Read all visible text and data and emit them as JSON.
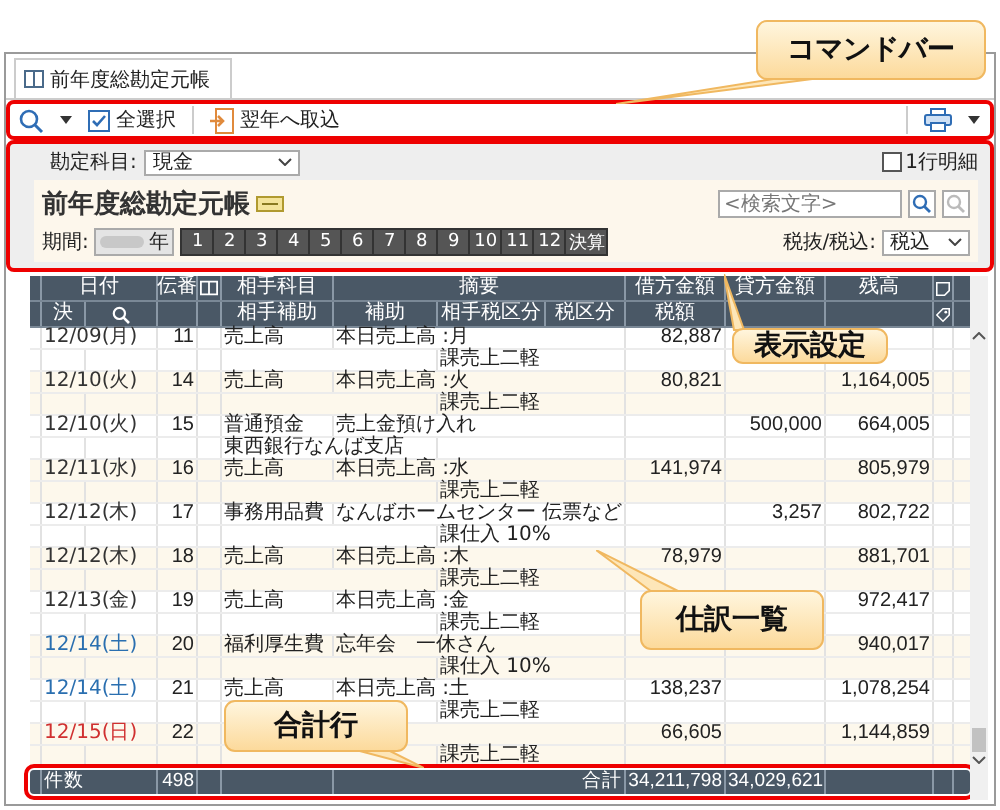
{
  "window": {
    "tab": {
      "label": "前年度総勘定元帳",
      "selected": true
    }
  },
  "command_bar": {
    "items": [
      {
        "kind": "search"
      },
      {
        "kind": "dropdown"
      },
      {
        "kind": "select_all",
        "label": "全選択"
      },
      {
        "kind": "import",
        "label": "翌年へ取込"
      }
    ],
    "right": [
      {
        "kind": "print"
      },
      {
        "kind": "dropdown"
      }
    ]
  },
  "settings": {
    "account_label": "勘定科目:",
    "account_value": "現金",
    "one_line": {
      "label": "1行明細",
      "checked": false
    },
    "title": "前年度総勘定元帳",
    "search_placeholder": "<検索文字>",
    "period_label": "期間:",
    "year_suffix": "年",
    "months": [
      "1",
      "2",
      "3",
      "4",
      "5",
      "6",
      "7",
      "8",
      "9",
      "10",
      "11",
      "12",
      "決算"
    ],
    "tax_label": "税抜/税込:",
    "tax_value": "税込"
  },
  "table": {
    "header_top": {
      "date": "日付",
      "number": "伝番",
      "account": "相手科目",
      "summary": "摘要",
      "debit": "借方金額",
      "credit": "貸方金額",
      "balance": "残高"
    },
    "header_bottom": {
      "closing": "決",
      "sub_account": "相手補助",
      "aux": "補助",
      "partner_tax": "相手税区分",
      "tax": "税区分",
      "tax_amount": "税額"
    },
    "rows": [
      {
        "date": "12/09(月)",
        "color": "#333333",
        "number": "11",
        "account": "売上高",
        "summary": "本日売上高 :月",
        "debit": "82,887",
        "partner_tax": "課売上二軽"
      },
      {
        "date": "12/10(火)",
        "color": "#333333",
        "number": "14",
        "account": "売上高",
        "summary": "本日売上高 :火",
        "debit": "80,821",
        "balance": "1,164,005",
        "partner_tax": "課売上二軽"
      },
      {
        "date": "12/10(火)",
        "color": "#333333",
        "number": "15",
        "account": "普通預金",
        "summary": "売上金預け入れ",
        "credit": "500,000",
        "balance": "664,005",
        "sub_account": "東西銀行なんば支店"
      },
      {
        "date": "12/11(水)",
        "color": "#333333",
        "number": "16",
        "account": "売上高",
        "summary": "本日売上高 :水",
        "debit": "141,974",
        "balance": "805,979",
        "partner_tax": "課売上二軽"
      },
      {
        "date": "12/12(木)",
        "color": "#333333",
        "number": "17",
        "account": "事務用品費",
        "summary": "なんばホームセンター 伝票など",
        "credit": "3,257",
        "balance": "802,722",
        "partner_tax": "課仕入 10%"
      },
      {
        "date": "12/12(木)",
        "color": "#333333",
        "number": "18",
        "account": "売上高",
        "summary": "本日売上高 :木",
        "debit": "78,979",
        "balance": "881,701",
        "partner_tax": "課売上二軽"
      },
      {
        "date": "12/13(金)",
        "color": "#333333",
        "number": "19",
        "account": "売上高",
        "summary": "本日売上高 :金",
        "balance": "972,417",
        "partner_tax": "課売上二軽"
      },
      {
        "date": "12/14(土)",
        "color": "#2a6fb0",
        "number": "20",
        "account": "福利厚生費",
        "summary": "忘年会　一休さん",
        "balance": "940,017",
        "partner_tax": "課仕入 10%"
      },
      {
        "date": "12/14(土)",
        "color": "#2a6fb0",
        "number": "21",
        "account": "売上高",
        "summary": "本日売上高 :土",
        "debit": "138,237",
        "balance": "1,078,254",
        "partner_tax": "課売上二軽"
      },
      {
        "date": "12/15(日)",
        "color": "#d03030",
        "number": "22",
        "debit": "66,605",
        "balance": "1,144,859",
        "partner_tax": "課売上二軽"
      }
    ],
    "totals": {
      "count_label": "件数",
      "count": "498",
      "total_label": "合計",
      "debit": "34,211,798",
      "credit": "34,029,621"
    }
  },
  "callouts": [
    {
      "label": "コマンドバー"
    },
    {
      "label": "表示設定"
    },
    {
      "label": "仕訳一覧"
    },
    {
      "label": "合計行"
    }
  ]
}
